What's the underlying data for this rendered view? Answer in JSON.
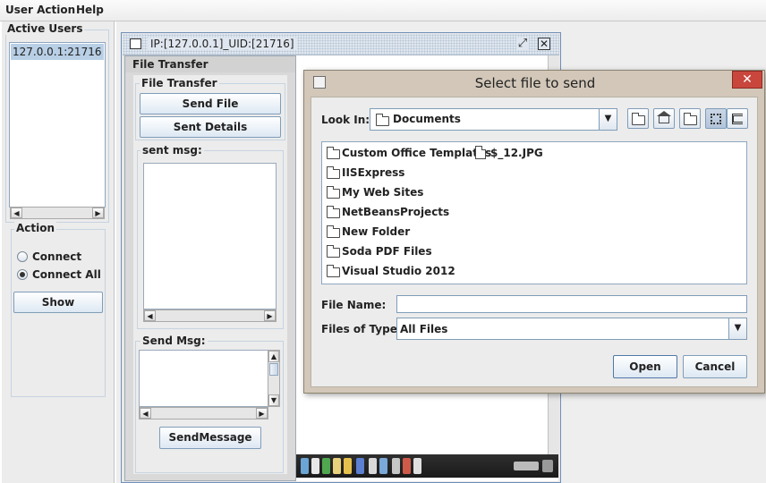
{
  "menubar": {
    "items": [
      "User Action",
      "Help"
    ]
  },
  "left_panel": {
    "active_users_title": "Active Users",
    "users": [
      "127.0.0.1:21716"
    ],
    "action_title": "Action",
    "radio_connect": "Connect",
    "radio_connect_all": "Connect All",
    "selected_radio": "Connect All",
    "show_button": "Show"
  },
  "chat_window": {
    "title": "IP:[127.0.0.1]_UID:[21716]",
    "file_transfer_frame_title": "File Transfer",
    "file_transfer_group": "File Transfer",
    "send_file_button": "Send File",
    "sent_details_button": "Sent Details",
    "sent_msg_label": "sent msg:",
    "send_msg_label": "Send Msg:",
    "send_message_button": "SendMessage"
  },
  "file_dialog": {
    "title": "Select file to send",
    "close_glyph": "✕",
    "look_in_label": "Look In:",
    "look_in_value": "Documents",
    "files": [
      {
        "name": "Custom Office Templates",
        "type": "folder"
      },
      {
        "name": "$_12.JPG",
        "type": "file"
      },
      {
        "name": "IISExpress",
        "type": "folder"
      },
      {
        "name": "My Web Sites",
        "type": "folder"
      },
      {
        "name": "NetBeansProjects",
        "type": "folder"
      },
      {
        "name": "New Folder",
        "type": "folder"
      },
      {
        "name": "Soda PDF Files",
        "type": "folder"
      },
      {
        "name": "Visual Studio 2012",
        "type": "folder"
      }
    ],
    "file_name_label": "File Name:",
    "file_name_value": "",
    "files_of_type_label": "Files of Type:",
    "files_of_type_value": "All Files",
    "open_button": "Open",
    "cancel_button": "Cancel",
    "toolbar_icons": [
      "up-folder-icon",
      "home-icon",
      "new-folder-icon",
      "list-view-icon",
      "details-view-icon"
    ]
  },
  "colors": {
    "selection": "#b8cfe5",
    "dialog_frame": "#d2c7b8",
    "close_button": "#c9463d",
    "button_border": "#7f9db9"
  }
}
